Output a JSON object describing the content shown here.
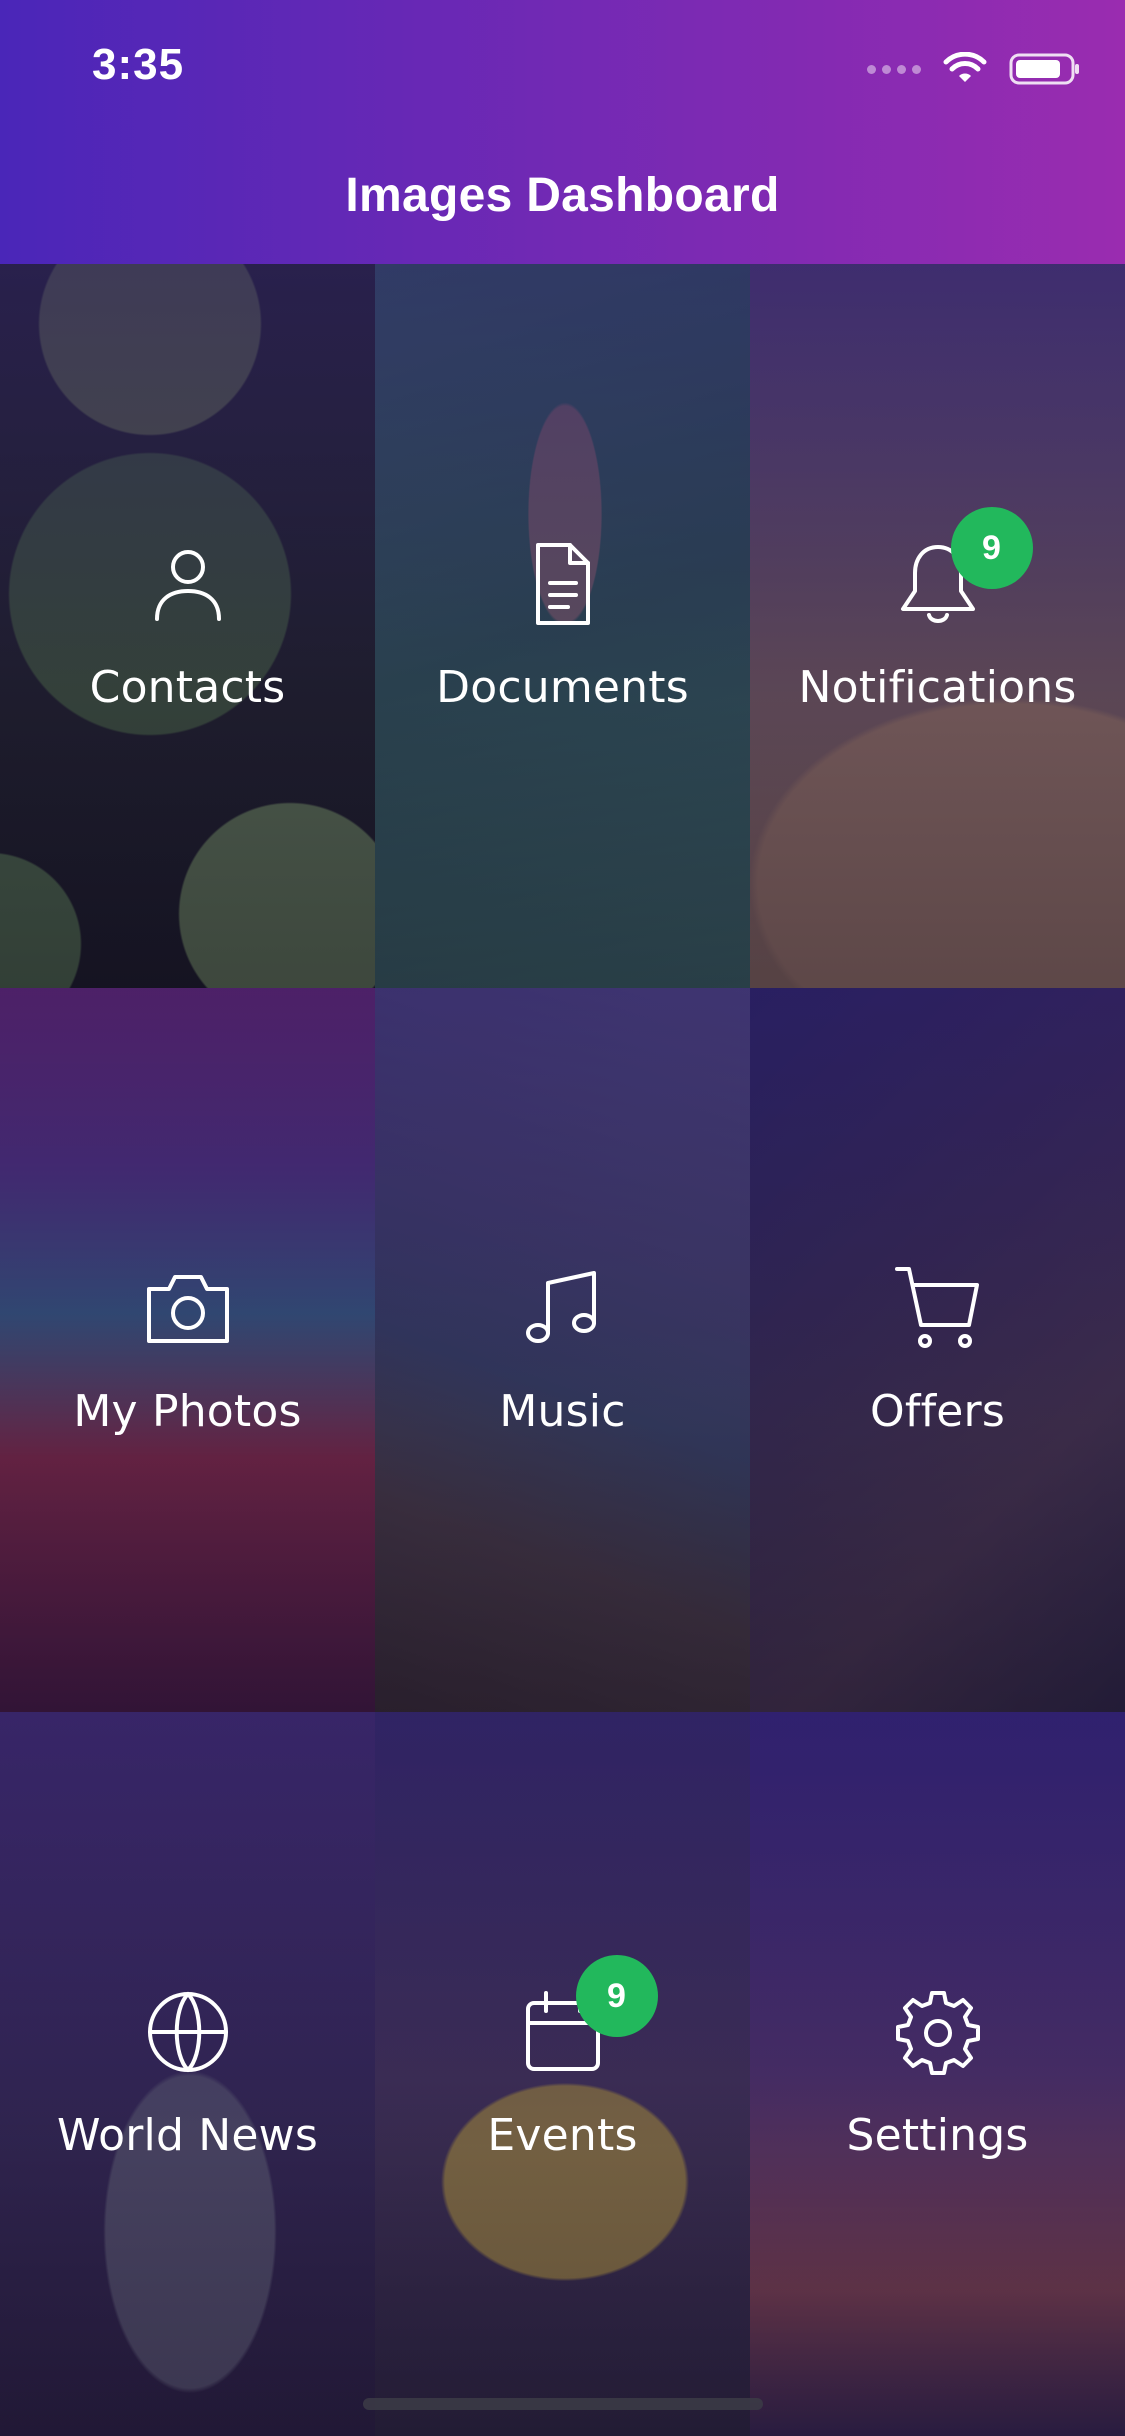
{
  "status_bar": {
    "time": "3:35"
  },
  "header": {
    "title": "Images Dashboard",
    "gradient_start": "#4a26b8",
    "gradient_end": "#9a2cb0"
  },
  "badge_color": "#22b85c",
  "tiles": [
    {
      "label": "Contacts",
      "icon": "person-icon"
    },
    {
      "label": "Documents",
      "icon": "document-icon"
    },
    {
      "label": "Notifications",
      "icon": "bell-icon",
      "badge": "9"
    },
    {
      "label": "My Photos",
      "icon": "camera-icon"
    },
    {
      "label": "Music",
      "icon": "music-note-icon"
    },
    {
      "label": "Offers",
      "icon": "cart-icon"
    },
    {
      "label": "World News",
      "icon": "globe-icon"
    },
    {
      "label": "Events",
      "icon": "calendar-icon",
      "badge": "9"
    },
    {
      "label": "Settings",
      "icon": "gear-icon"
    }
  ]
}
